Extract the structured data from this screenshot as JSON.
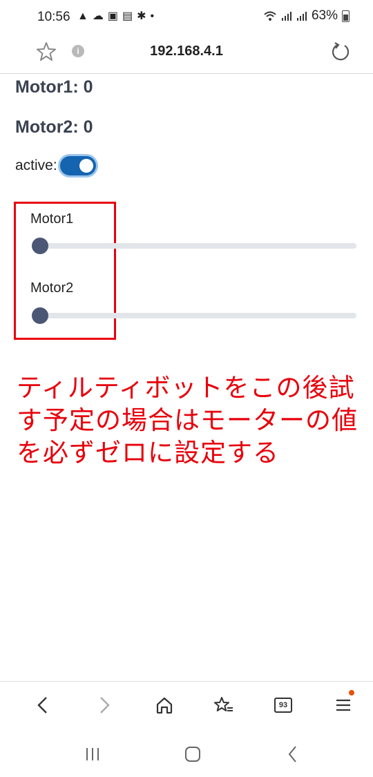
{
  "status_bar": {
    "time": "10:56",
    "notification_icons": [
      "warning-icon",
      "cloud-icon",
      "voicemail-icon",
      "camera-icon",
      "gear-icon",
      "dot-icon"
    ],
    "battery_percent": "63%",
    "right_icons": [
      "wifi-icon",
      "signal-icon",
      "signal-icon",
      "battery-icon"
    ]
  },
  "address_bar": {
    "url": "192.168.4.1"
  },
  "page": {
    "motor1_heading": "Motor1: 0",
    "motor2_heading": "Motor2: 0",
    "active_label": "active:",
    "active_on": true,
    "sliders": [
      {
        "label": "Motor1",
        "value": 0
      },
      {
        "label": "Motor2",
        "value": 0
      }
    ],
    "annotation": "ティルティボットをこの後試す予定の場合はモーターの値を必ずゼロに設定する"
  },
  "toolbar": {
    "tabs_count": "93"
  },
  "colors": {
    "accent": "#1464b0",
    "annotation_red": "#e8000b",
    "slider_thumb": "#4b5775",
    "heading": "#3b4252"
  }
}
